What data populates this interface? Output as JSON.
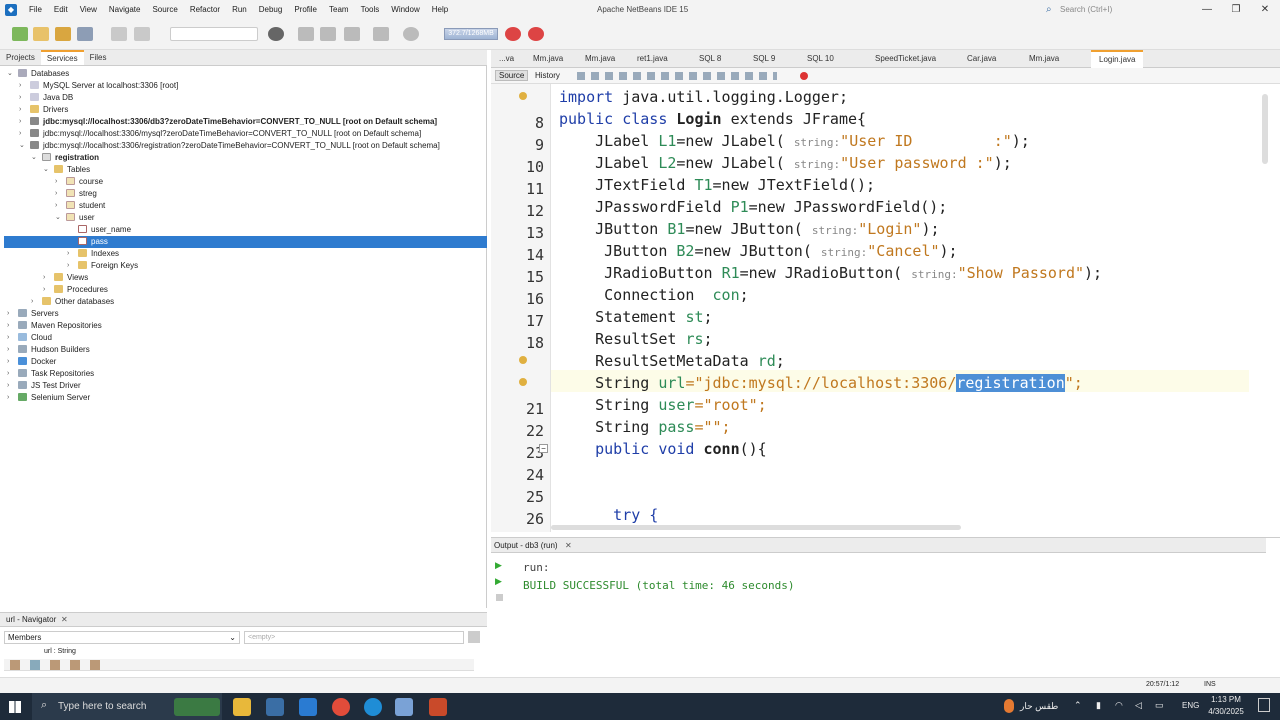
{
  "titlebar": {
    "menus": [
      "File",
      "Edit",
      "View",
      "Navigate",
      "Source",
      "Refactor",
      "Run",
      "Debug",
      "Profile",
      "Team",
      "Tools",
      "Window",
      "Help"
    ],
    "app_title": "Apache NetBeans IDE 15",
    "search_placeholder": "Search (Ctrl+I)"
  },
  "toolbar": {
    "memory": "372.7/1268MB"
  },
  "left": {
    "tabs": [
      "Projects",
      "Services",
      "Files"
    ],
    "tree": [
      {
        "label": "Databases",
        "bold": false
      },
      {
        "label": "MySQL Server at localhost:3306 [root]"
      },
      {
        "label": "Java DB"
      },
      {
        "label": "Drivers"
      },
      {
        "label": "jdbc:mysql://localhost:3306/db3?zeroDateTimeBehavior=CONVERT_TO_NULL [root on Default schema]",
        "bold": true
      },
      {
        "label": "jdbc:mysql://localhost:3306/mysql?zeroDateTimeBehavior=CONVERT_TO_NULL [root on Default schema]"
      },
      {
        "label": "jdbc:mysql://localhost:3306/registration?zeroDateTimeBehavior=CONVERT_TO_NULL [root on Default schema]"
      },
      {
        "label": "registration",
        "bold": true
      },
      {
        "label": "Tables"
      },
      {
        "label": "course"
      },
      {
        "label": "streg"
      },
      {
        "label": "student"
      },
      {
        "label": "user"
      },
      {
        "label": "user_name"
      },
      {
        "label": "pass"
      },
      {
        "label": "Indexes"
      },
      {
        "label": "Foreign Keys"
      },
      {
        "label": "Views"
      },
      {
        "label": "Procedures"
      },
      {
        "label": "Other databases"
      },
      {
        "label": "Servers"
      },
      {
        "label": "Maven Repositories"
      },
      {
        "label": "Cloud"
      },
      {
        "label": "Hudson Builders"
      },
      {
        "label": "Docker"
      },
      {
        "label": "Task Repositories"
      },
      {
        "label": "JS Test Driver"
      },
      {
        "label": "Selenium Server"
      }
    ]
  },
  "navigator": {
    "title": "url - Navigator",
    "members_label": "Members",
    "filter_placeholder": "<empty>",
    "item": "url : String"
  },
  "editor": {
    "tabs": [
      "...va",
      "Mm.java",
      "Mm.java",
      "ret1.java",
      "SQL 8",
      "SQL 9",
      "SQL 10",
      "SpeedTicket.java",
      "Car.java",
      "Mm.java",
      "Login.java"
    ],
    "active_tab": "Login.java",
    "source_label": "Source",
    "history_label": "History",
    "line_numbers": [
      "8",
      "9",
      "10",
      "11",
      "12",
      "13",
      "14",
      "15",
      "16",
      "17",
      "18",
      "",
      "21",
      "22",
      "23",
      "24",
      "25",
      "26"
    ],
    "code": {
      "l0": "import java.util.logging.Logger;",
      "l1a": "public class ",
      "l1b": "Login",
      "l1c": " extends JFrame{",
      "l2a": "    JLabel ",
      "l2b": "L1",
      "l2c": "=new JLabel( ",
      "l2d": "string:",
      "l2e": "\"User ID         :\"",
      "l3a": "    JLabel ",
      "l3b": "L2",
      "l3c": "=new JLabel( ",
      "l3d": "string:",
      "l3e": "\"User password :\"",
      "l4a": "    JTextField ",
      "l4b": "T1",
      "l4c": "=new JTextField();",
      "l5a": "    JPasswordField ",
      "l5b": "P1",
      "l5c": "=new JPasswordField();",
      "l6a": "    JButton ",
      "l6b": "B1",
      "l6c": "=new JButton( ",
      "l6d": "string:",
      "l6e": "\"Login\"",
      "l7a": "     JButton ",
      "l7b": "B2",
      "l7c": "=new JButton( ",
      "l7d": "string:",
      "l7e": "\"Cancel\"",
      "l8a": "     JRadioButton ",
      "l8b": "R1",
      "l8c": "=new JRadioButton( ",
      "l8d": "string:",
      "l8e": "\"Show Passord\"",
      "l9a": "     Connection  ",
      "l9b": "con",
      "l10a": "    Statement ",
      "l10b": "st",
      "l11a": "    ResultSet ",
      "l11b": "rs",
      "l12a": "    ResultSetMetaData ",
      "l12b": "rd",
      "l13a": "    String ",
      "l13b": "url",
      "l13c": "=\"jdbc:mysql://localhost:3306/",
      "l13d": "registration",
      "l13e": "\";",
      "l14a": "    String ",
      "l14b": "user",
      "l14c": "=\"root\";",
      "l15a": "    String ",
      "l15b": "pass",
      "l15c": "=\"\";",
      "l16a": "    public void ",
      "l16b": "conn",
      "l16c": "(){",
      "l19": "      try {"
    }
  },
  "output": {
    "title": "Output - db3 (run)",
    "line1": "run:",
    "line2": "BUILD SUCCESSFUL (total time: 46 seconds)"
  },
  "status": {
    "position": "20:57/1:12",
    "mode": "INS"
  },
  "taskbar": {
    "search_placeholder": "Type here to search",
    "weather": "طقس حار",
    "lang": "ENG",
    "time": "1:13 PM",
    "date": "4/30/2025"
  }
}
